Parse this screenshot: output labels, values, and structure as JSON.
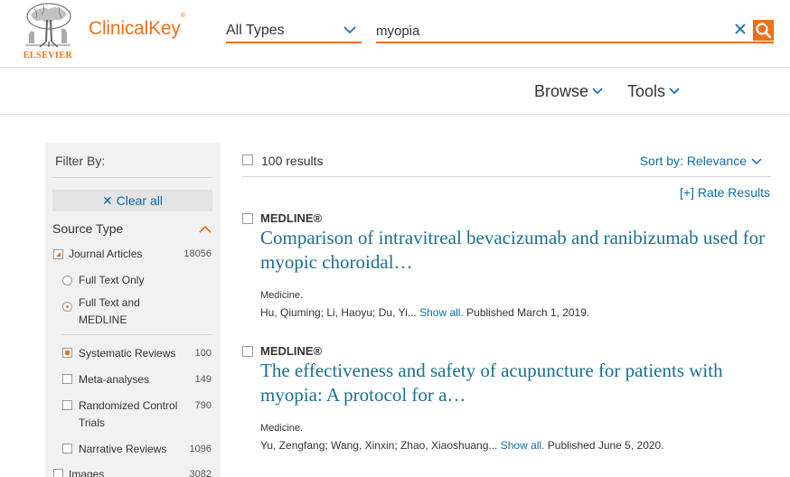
{
  "header": {
    "logo_text": "ELSEVIER",
    "brand": "ClinicalKey",
    "brand_mark": "®",
    "type_select": "All Types",
    "search_value": "myopia",
    "search_placeholder": ""
  },
  "nav": {
    "browse": "Browse",
    "tools": "Tools"
  },
  "sidebar": {
    "filter_by": "Filter By:",
    "clear_all": "Clear all",
    "source_type": "Source Type",
    "items": [
      {
        "label": "Journal Articles",
        "count": "18056",
        "control": "checkbox-partial"
      },
      {
        "label": "Full Text Only",
        "count": "",
        "control": "radio"
      },
      {
        "label": "Full Text and MEDLINE",
        "count": "",
        "control": "radio-selected"
      },
      {
        "label": "Systematic Reviews",
        "count": "100",
        "control": "checkbox-checked"
      },
      {
        "label": "Meta-analyses",
        "count": "149",
        "control": "checkbox"
      },
      {
        "label": "Randomized Control Trials",
        "count": "790",
        "control": "checkbox"
      },
      {
        "label": "Narrative Reviews",
        "count": "1096",
        "control": "checkbox"
      },
      {
        "label": "Images",
        "count": "3082",
        "control": "checkbox"
      }
    ]
  },
  "results": {
    "count": "100 results",
    "sort_label": "Sort by: Relevance",
    "rate": "[+] Rate Results",
    "items": [
      {
        "source": "MEDLINE®",
        "title": "Comparison of intravitreal bevacizumab and ranibizumab used for myopic choroidal…",
        "journal": "Medicine.",
        "authors": "Hu, Qiuming; Li, Haoyu; Du, Yi...",
        "show_all": "Show all.",
        "published": "Published March 1, 2019."
      },
      {
        "source": "MEDLINE®",
        "title": "The effectiveness and safety of acupuncture for patients with myopia: A protocol for a…",
        "journal": "Medicine.",
        "authors": "Yu, Zengfang; Wang, Xinxin; Zhao, Xiaoshuang...",
        "show_all": "Show all.",
        "published": "Published June 5, 2020."
      }
    ]
  },
  "colors": {
    "accent": "#e9711c",
    "link": "#0e6ea6",
    "title": "#1b6f8f",
    "sidebar_bg": "#f1f1f1"
  },
  "icons": {
    "logo": "elsevier-tree-logo",
    "select_chevron": "chevron-down-icon",
    "clear": "close-icon",
    "search": "search-icon",
    "collapse": "chevron-up-icon",
    "sort_chevron": "chevron-down-icon"
  }
}
